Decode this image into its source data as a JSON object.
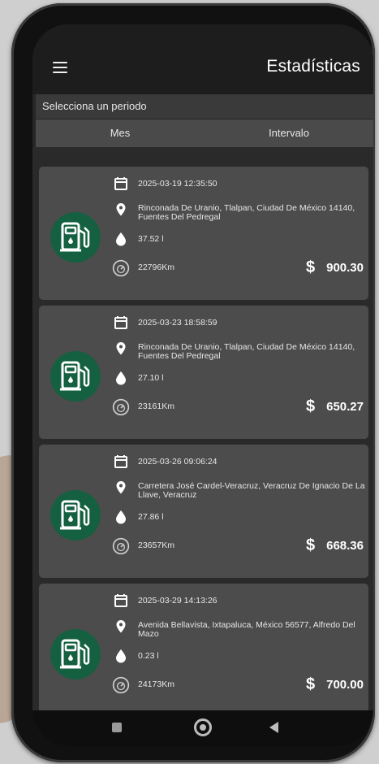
{
  "app": {
    "title": "Estadísticas"
  },
  "period": {
    "label": "Selecciona un periodo",
    "tabs": [
      {
        "label": "Mes"
      },
      {
        "label": "Intervalo"
      }
    ]
  },
  "records": [
    {
      "date": "2025-03-19 12:35:50",
      "address": "Rinconada De Uranio, Tlalpan, Ciudad De México 14140, Fuentes Del Pedregal",
      "volume": "37.52 l",
      "odometer": "22796Km",
      "currency": "$",
      "amount": "900.30"
    },
    {
      "date": "2025-03-23 18:58:59",
      "address": "Rinconada De Uranio, Tlalpan, Ciudad De México 14140, Fuentes Del Pedregal",
      "volume": "27.10 l",
      "odometer": "23161Km",
      "currency": "$",
      "amount": "650.27"
    },
    {
      "date": "2025-03-26 09:06:24",
      "address": "Carretera José Cardel-Veracruz, Veracruz De Ignacio De La Llave, Veracruz",
      "volume": "27.86 l",
      "odometer": "23657Km",
      "currency": "$",
      "amount": "668.36"
    },
    {
      "date": "2025-03-29 14:13:26",
      "address": "Avenida Bellavista, Ixtapaluca, México 56577, Alfredo Del Mazo",
      "volume": "0.23 l",
      "odometer": "24173Km",
      "currency": "$",
      "amount": "700.00"
    }
  ],
  "colors": {
    "accent": "#146040",
    "card": "#4c4c4c",
    "background": "#262626"
  },
  "icons": [
    "menu-icon",
    "calendar-icon",
    "location-pin-icon",
    "drop-icon",
    "odometer-icon",
    "fuel-pump-icon",
    "nav-recents-icon",
    "nav-home-icon",
    "nav-back-icon"
  ]
}
